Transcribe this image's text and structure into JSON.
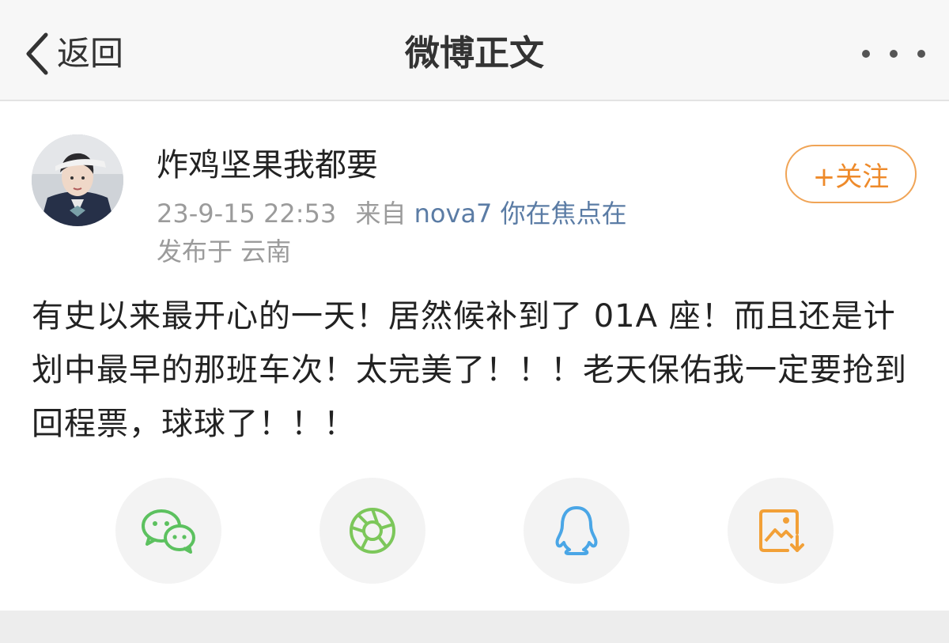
{
  "header": {
    "back_label": "返回",
    "title": "微博正文"
  },
  "author": {
    "name": "炸鸡坚果我都要",
    "timestamp": "23-9-15 22:53",
    "source_prefix": "来自",
    "source_name": "nova7 你在焦点在",
    "location": "发布于 云南",
    "follow_label": "+关注"
  },
  "post": {
    "text": "有史以来最开心的一天！居然候补到了 01A 座！而且还是计划中最早的那班车次！太完美了！！！老天保佑我一定要抢到回程票，球球了！！！"
  },
  "share": [
    {
      "icon": "wechat-icon",
      "color": "#5cc15f"
    },
    {
      "icon": "moments-icon",
      "color": "#7cc75a"
    },
    {
      "icon": "qq-icon",
      "color": "#4aa6e6"
    },
    {
      "icon": "save-image-icon",
      "color": "#f2a037"
    }
  ],
  "colors": {
    "accent": "#ee8a2a",
    "link": "#5b7ca5",
    "muted": "#9b9b9b"
  }
}
